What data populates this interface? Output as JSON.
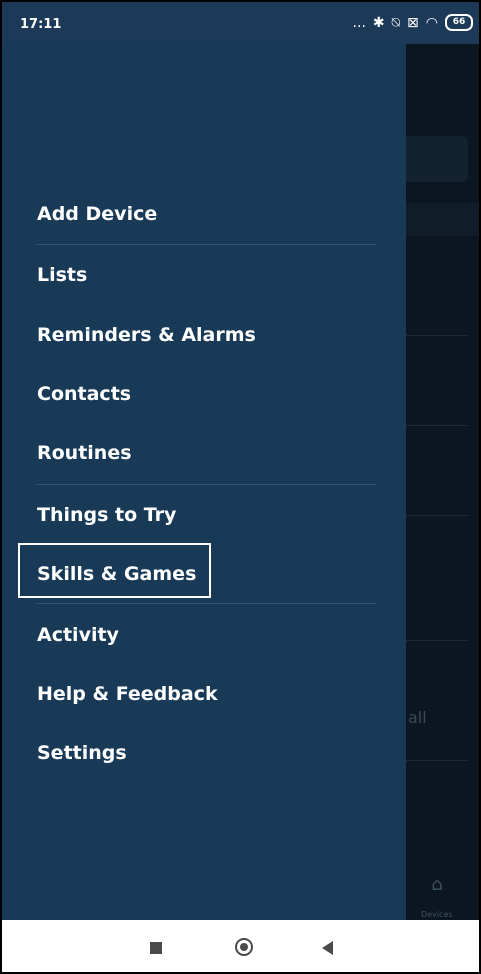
{
  "status_bar": {
    "time": "17:11",
    "icons": [
      "more-icon",
      "bluetooth-icon",
      "mute-icon",
      "sim-icon",
      "wifi-icon"
    ],
    "more_glyph": "...",
    "battery": "66"
  },
  "drawer": {
    "items": [
      {
        "label": "Add Device"
      },
      {
        "label": "Lists"
      },
      {
        "label": "Reminders & Alarms"
      },
      {
        "label": "Contacts"
      },
      {
        "label": "Routines"
      },
      {
        "label": "Things to Try"
      },
      {
        "label": "Skills & Games",
        "highlighted": true
      },
      {
        "label": "Activity"
      },
      {
        "label": "Help & Feedback"
      },
      {
        "label": "Settings"
      }
    ]
  },
  "background": {
    "partial_text": "all",
    "tab_label": "Devices"
  },
  "colors": {
    "drawer_bg": "#183a57",
    "overlay_bg": "#0b1620",
    "text": "#ffffff"
  }
}
